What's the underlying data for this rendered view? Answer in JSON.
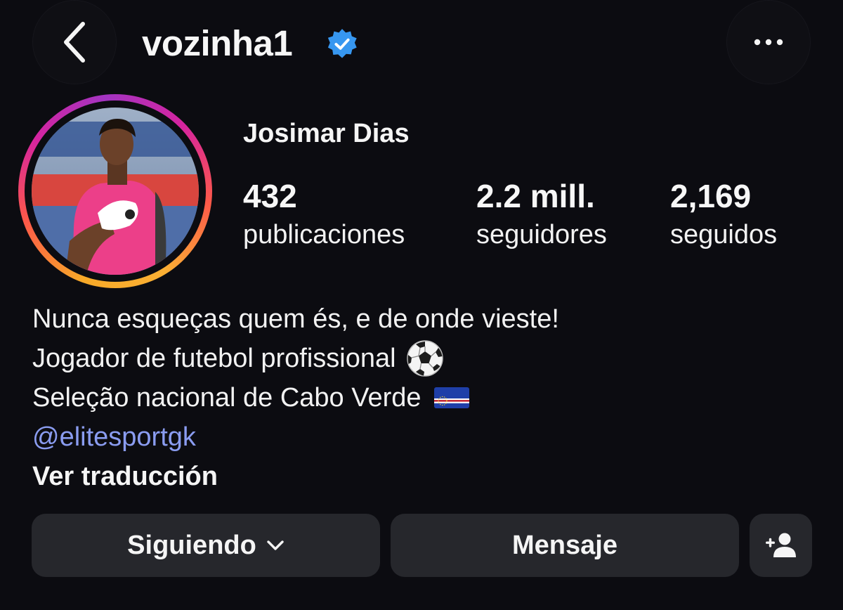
{
  "header": {
    "username": "vozinha1",
    "verified": true,
    "back_icon": "chevron-left-icon",
    "more_icon": "more-horizontal-icon"
  },
  "profile": {
    "full_name": "Josimar Dias",
    "stats": [
      {
        "value": "432",
        "label": "publicaciones"
      },
      {
        "value": "2.2 mill.",
        "label": "seguidores"
      },
      {
        "value": "2,169",
        "label": "seguidos"
      }
    ],
    "story_ring_colors": [
      "#fbb034",
      "#fd5949",
      "#d6249f",
      "#a334c2"
    ]
  },
  "bio": {
    "line1": "Nunca esqueças quem és, e de onde vieste!",
    "line2": "Jogador de futebol profissional",
    "line2_emoji": "soccer-ball-icon",
    "line3": "Seleção nacional de Cabo Verde",
    "line3_emoji": "cape-verde-flag-icon",
    "mention": "@elitesportgk",
    "see_translation": "Ver traducción"
  },
  "actions": {
    "following_label": "Siguiendo",
    "message_label": "Mensaje",
    "add_person_icon": "add-person-icon"
  },
  "colors": {
    "background": "#0c0c11",
    "button_bg": "#26272c",
    "mention": "#8a9cf0",
    "verified_blue": "#3797f0"
  }
}
